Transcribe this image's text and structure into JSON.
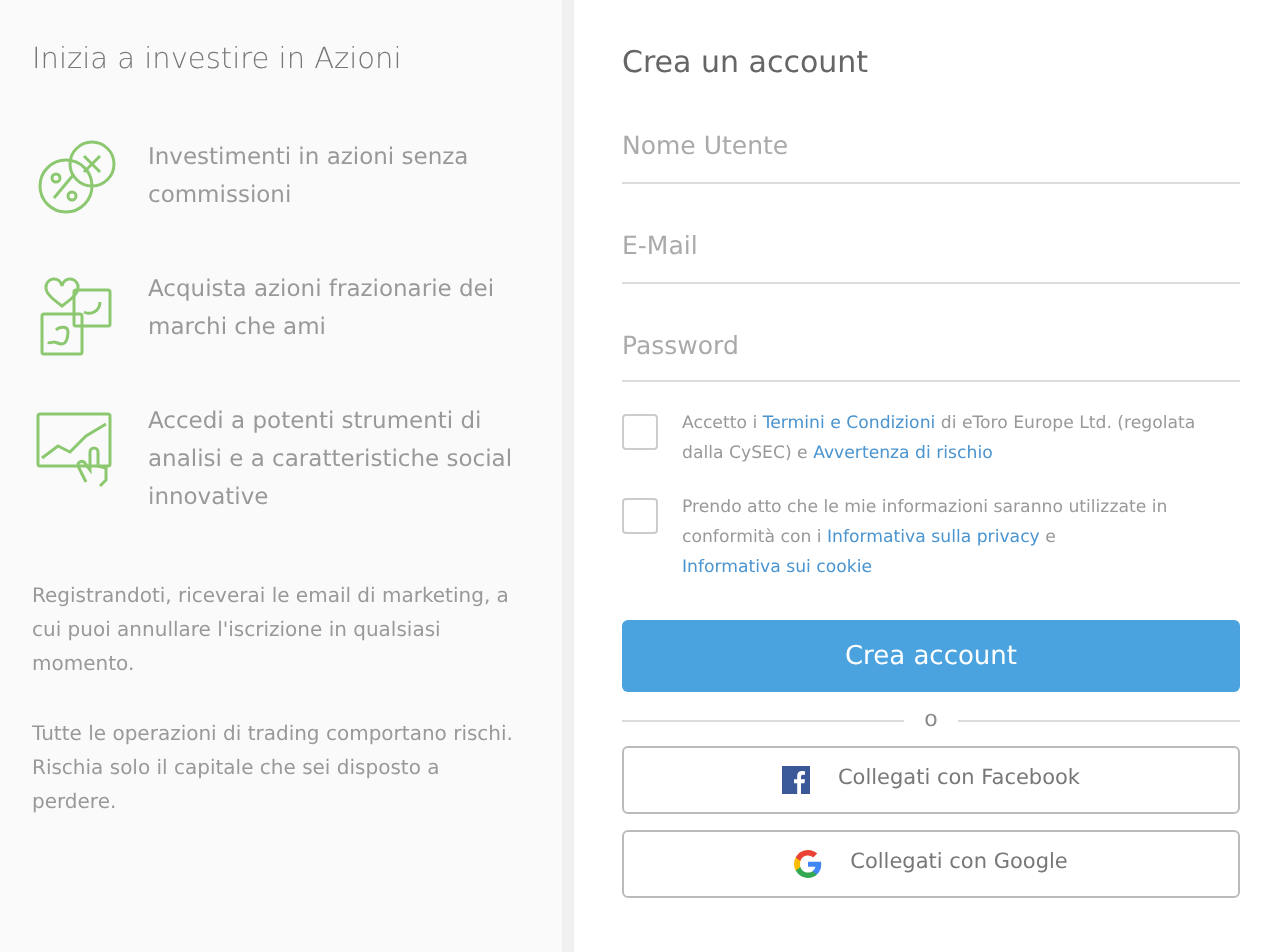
{
  "intro": {
    "title": "Inizia a investire in Azioni",
    "features": [
      {
        "kind": "commission",
        "text": "Investimenti in azioni senza commissioni"
      },
      {
        "kind": "brands",
        "text": "Acquista azioni frazionarie dei marchi che ami"
      },
      {
        "kind": "tools",
        "text": "Accedi a potenti strumenti di analisi e a caratteristiche social innovative"
      }
    ],
    "notes": [
      "Registrandoti, riceverai le email di marketing, a cui puoi annullare l'iscrizione in qualsiasi momento.",
      "Tutte le operazioni di trading comportano rischi. Rischia solo il capitale che sei disposto a perdere."
    ]
  },
  "form": {
    "title": "Crea un account",
    "fields": [
      {
        "placeholder": "Nome Utente"
      },
      {
        "placeholder": "E-Mail"
      },
      {
        "placeholder": "Password"
      }
    ],
    "consents": [
      {
        "checked": false,
        "parts": [
          {
            "text": "Accetto i ",
            "link": false
          },
          {
            "text": "Termini e Condizioni",
            "link": true
          },
          {
            "text": " di eToro Europe Ltd. (regolata dalla CySEC) e ",
            "link": false
          },
          {
            "text": "Avvertenza di rischio",
            "link": true
          }
        ]
      },
      {
        "checked": false,
        "parts": [
          {
            "text": "Prendo atto che le mie informazioni saranno utilizzate in conformità con i ",
            "link": false
          },
          {
            "text": "Informativa sulla privacy",
            "link": true
          },
          {
            "text": " e ",
            "link": false
          },
          {
            "text": "Informativa sui cookie",
            "link": true
          }
        ]
      }
    ],
    "submit": "Crea account",
    "divider": "o",
    "social": [
      {
        "kind": "facebook",
        "label": "Collegati con Facebook"
      },
      {
        "kind": "google",
        "label": "Collegati con Google"
      }
    ]
  }
}
